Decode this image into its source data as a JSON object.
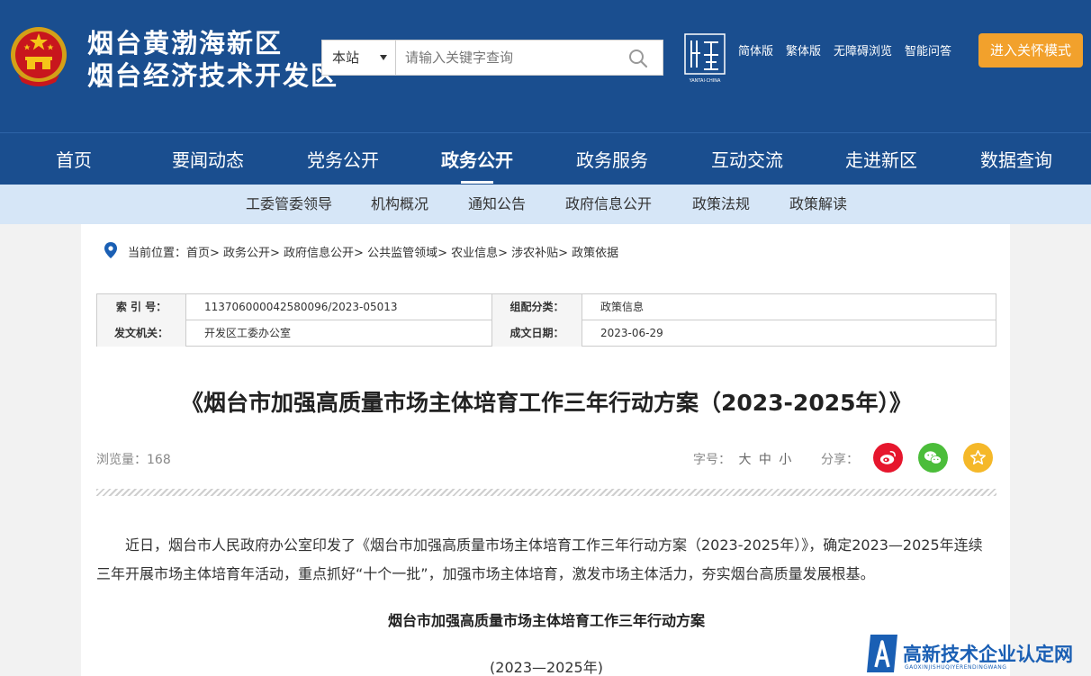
{
  "header": {
    "title_line1": "烟台黄渤海新区",
    "title_line2": "烟台经济技术开发区",
    "search_scope": "本站",
    "search_placeholder": "请输入关键字查询",
    "china_logo_text": "YANTAI·CHINA",
    "top_links": [
      "简体版",
      "繁体版",
      "无障碍浏览",
      "智能问答"
    ],
    "care_mode": "进入关怀模式"
  },
  "mainnav": [
    "首页",
    "要闻动态",
    "党务公开",
    "政务公开",
    "政务服务",
    "互动交流",
    "走进新区",
    "数据查询"
  ],
  "mainnav_active": "政务公开",
  "subnav": [
    "工委管委领导",
    "机构概况",
    "通知公告",
    "政府信息公开",
    "政策法规",
    "政策解读"
  ],
  "breadcrumb": "当前位置：首页> 政务公开> 政府信息公开> 公共监管领域> 农业信息> 涉农补贴> 政策依据",
  "meta": {
    "index_label": "索 引 号：",
    "index_value": "113706000042580096/2023-05013",
    "category_label": "组配分类：",
    "category_value": "政策信息",
    "issuer_label": "发文机关：",
    "issuer_value": "开发区工委办公室",
    "date_label": "成文日期：",
    "date_value": "2023-06-29"
  },
  "article": {
    "title": "《烟台市加强高质量市场主体培育工作三年行动方案（2023-2025年）》",
    "views": "浏览量：168",
    "font_label": "字号：",
    "font_options": [
      "大",
      "中",
      "小"
    ],
    "share_label": "分享：",
    "paragraph": "近日，烟台市人民政府办公室印发了《烟台市加强高质量市场主体培育工作三年行动方案（2023-2025年）》，确定2023—2025年连续三年开展市场主体培育年活动，重点抓好“十个一批”，加强市场主体培育，激发市场主体活力，夯实烟台高质量发展根基。",
    "sub_heading": "烟台市加强高质量市场主体培育工作三年行动方案",
    "years": "(2023—2025年)"
  },
  "watermark": {
    "text": "高新技术企业认定网",
    "sub": "GAOXINJISHUQIYERENDINGWANG"
  },
  "colors": {
    "header_bg": "#1a4e8f",
    "subnav_bg": "#d6e6f7",
    "care_btn": "#f2a12c",
    "weibo": "#e6162d",
    "wechat": "#4bbd3a",
    "favorite": "#f5b829"
  },
  "icons": [
    "national-emblem-icon",
    "search-icon",
    "location-pin-icon",
    "weibo-icon",
    "wechat-icon",
    "star-icon"
  ]
}
